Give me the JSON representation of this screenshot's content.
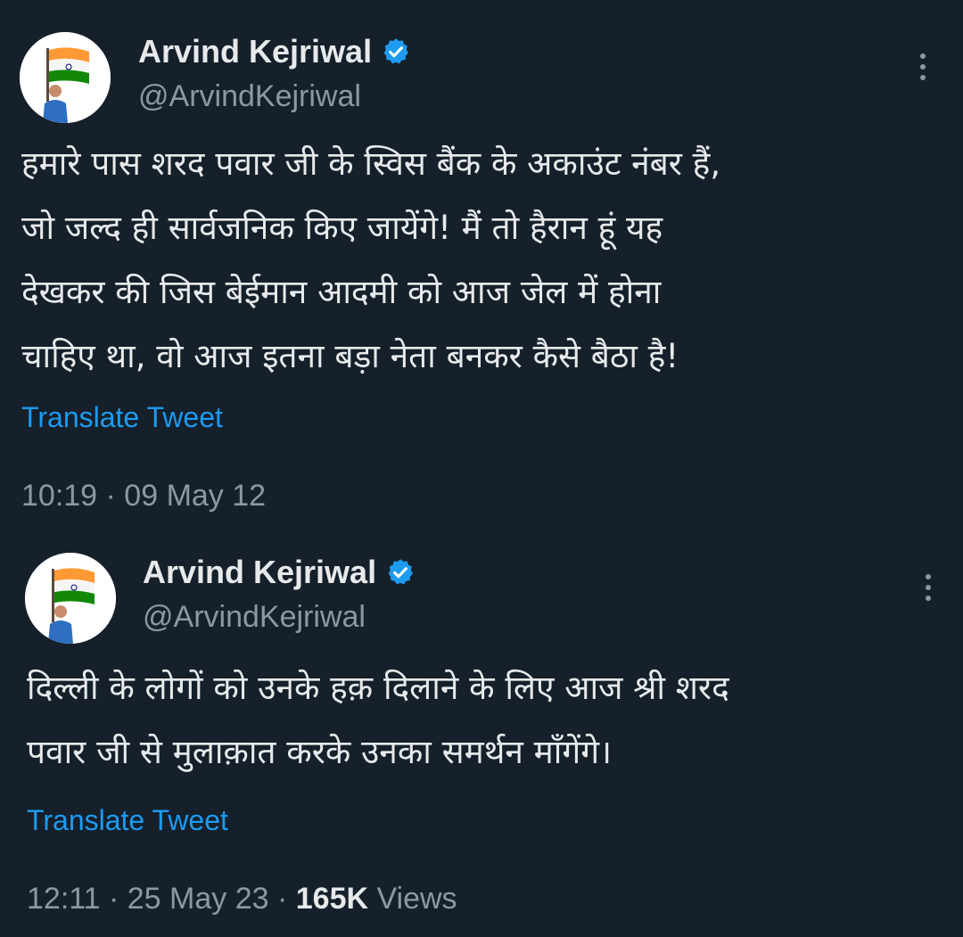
{
  "tweets": [
    {
      "author_name": "Arvind Kejriwal",
      "handle": "@ArvindKejriwal",
      "verified": true,
      "text": "हमारे पास शरद पवार जी के स्विस बैंक के अकाउंट नंबर हैं,\nजो जल्द ही सार्वजनिक किए जायेंगे! मैं तो हैरान हूं यह\nदेखकर की जिस बेईमान आदमी को आज जेल में होना\nचाहिए था, वो आज इतना बड़ा नेता बनकर कैसे बैठा है!",
      "translate_label": "Translate Tweet",
      "timestamp": "10:19 · 09 May 12"
    },
    {
      "author_name": "Arvind Kejriwal",
      "handle": "@ArvindKejriwal",
      "verified": true,
      "text": "दिल्ली के लोगों को उनके हक़ दिलाने के लिए आज श्री शरद\nपवार जी से मुलाक़ात करके उनका समर्थन माँगेंगे।",
      "translate_label": "Translate Tweet",
      "timestamp": "12:11 · 25 May 23 · ",
      "views_count": "165K",
      "views_label": " Views"
    }
  ],
  "icons": {
    "verified": "verified-badge-icon",
    "more": "more-options-icon"
  },
  "colors": {
    "background": "#15202b",
    "link": "#1d9bf0",
    "secondary_text": "#8b98a5",
    "primary_text": "#e7e9ea",
    "verified": "#1d9bf0"
  }
}
